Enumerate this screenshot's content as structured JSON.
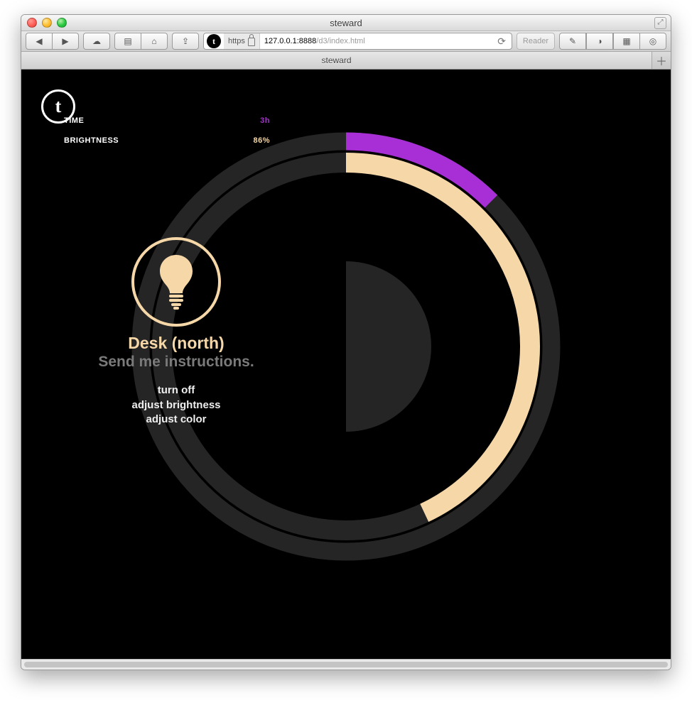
{
  "window": {
    "title": "steward"
  },
  "toolbar": {
    "scheme": "https",
    "host": "127.0.0.1:8888",
    "path": "/d3/index.html",
    "reader_label": "Reader"
  },
  "tabs": [
    {
      "label": "steward"
    }
  ],
  "logo_letter": "t",
  "rings": {
    "time": {
      "label": "TIME",
      "value_text": "3h",
      "fraction": 0.125,
      "color": "#a82ed6",
      "radius": 289,
      "width": 25
    },
    "brightness": {
      "label": "BRIGHTNESS",
      "value_text": "86%",
      "fraction": 0.43,
      "color": "#f6d7a8",
      "radius": 259,
      "width": 28
    }
  },
  "device": {
    "name": "Desk (north)",
    "subtitle": "Send me instructions.",
    "commands": [
      "turn off",
      "adjust brightness",
      "adjust color"
    ]
  },
  "colors": {
    "ring_bg": "#252525",
    "inner_bg": "#252525",
    "content_bg": "#000000",
    "accent_cream": "#f6d7a8",
    "accent_purple": "#a82ed6"
  }
}
